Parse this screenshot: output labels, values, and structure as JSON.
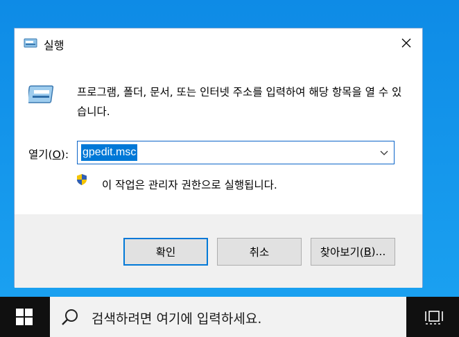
{
  "dialog": {
    "title": "실행",
    "description": "프로그램, 폴더, 문서, 또는 인터넷 주소를 입력하여 해당 항목을 열 수 있습니다.",
    "open_label_prefix": "열기(",
    "open_label_key": "O",
    "open_label_suffix": "):",
    "input_value": "gpedit.msc",
    "admin_note": "이 작업은 관리자 권한으로 실행됩니다.",
    "buttons": {
      "ok": "확인",
      "cancel": "취소",
      "browse_prefix": "찾아보기(",
      "browse_key": "B",
      "browse_suffix": ")..."
    }
  },
  "taskbar": {
    "search_placeholder": "검색하려면 여기에 입력하세요."
  },
  "icons": [
    "run-icon",
    "close-icon",
    "chevron-down-icon",
    "uac-shield-icon",
    "windows-logo-icon",
    "search-icon",
    "task-view-icon"
  ],
  "colors": {
    "desktop": "#0e8be6",
    "accent": "#0078d7",
    "taskbar": "#101010",
    "footer": "#f0f0f0"
  }
}
